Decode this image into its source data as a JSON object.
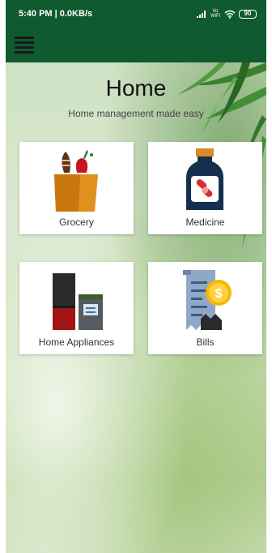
{
  "status_bar": {
    "time_network": "5:40 PM | 0.0KB/s",
    "vowifi_top": "Vo",
    "vowifi_bottom": "WiFi",
    "battery": "90"
  },
  "app_bar": {
    "menu_icon": "hamburger-menu-icon"
  },
  "header": {
    "title": "Home",
    "subtitle": "Home management made easy"
  },
  "cards": [
    {
      "label": "Grocery",
      "icon": "grocery-bag-icon"
    },
    {
      "label": "Medicine",
      "icon": "medicine-bottle-icon"
    },
    {
      "label": "Home Appliances",
      "icon": "appliances-icon"
    },
    {
      "label": "Bills",
      "icon": "bill-receipt-icon"
    }
  ],
  "colors": {
    "app_bar": "#0f5a2e",
    "card_bg": "#ffffff"
  }
}
